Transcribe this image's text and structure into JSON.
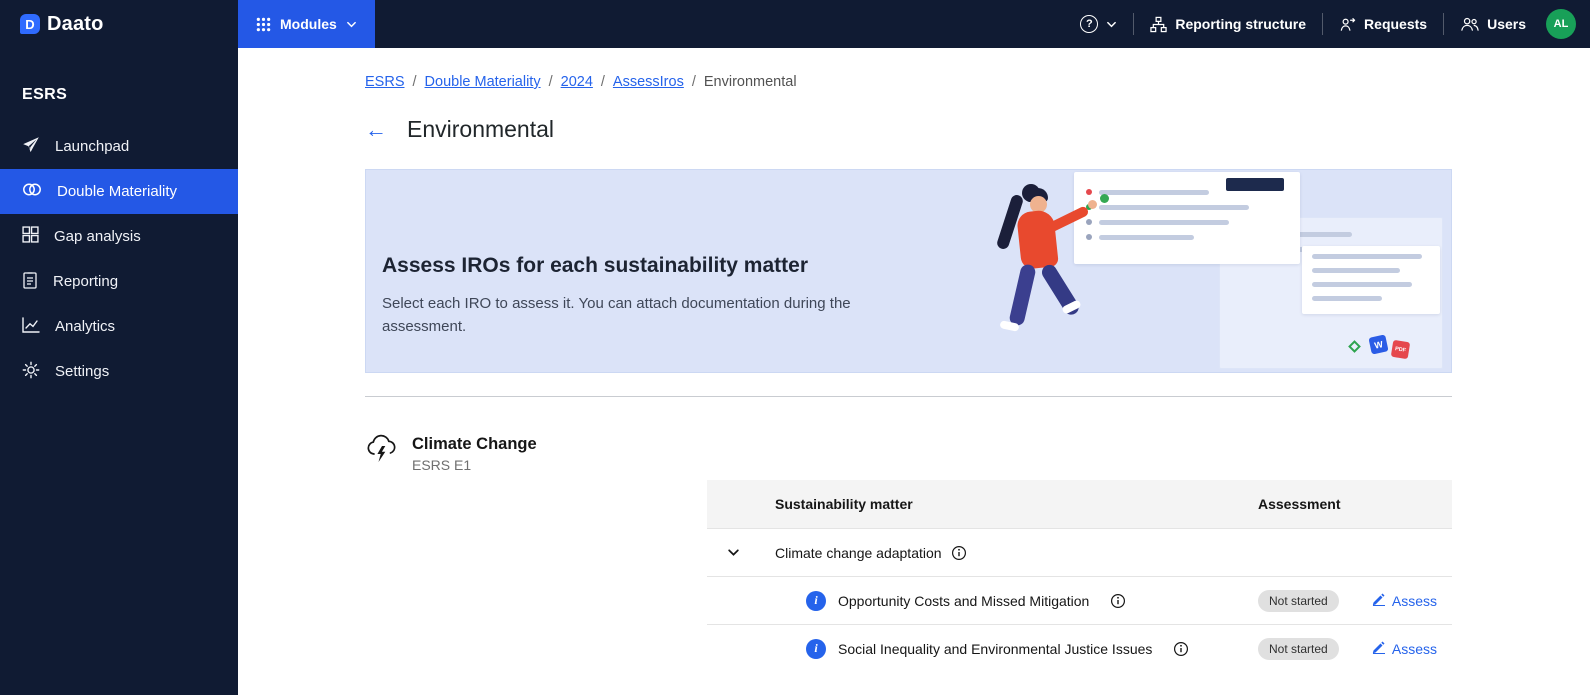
{
  "colors": {
    "navy": "#101b33",
    "accent_blue": "#2458e6",
    "link_blue": "#2563eb",
    "banner_bg": "#dbe3f8",
    "badge_bg": "#e0e0e0",
    "avatar_green": "#18a058"
  },
  "icons": {
    "back": "←",
    "help": "?",
    "info_badge": "i",
    "logo_letter": "D"
  },
  "topbar": {
    "brand": "Daato",
    "modules_label": "Modules",
    "modules_icon": "grid-icon",
    "nav": [
      {
        "label": "Reporting structure",
        "icon": "hierarchy-icon"
      },
      {
        "label": "Requests",
        "icon": "request-user-icon"
      },
      {
        "label": "Users",
        "icon": "users-icon"
      }
    ],
    "avatar_initials": "AL"
  },
  "sidebar": {
    "heading": "ESRS",
    "items": [
      {
        "label": "Launchpad",
        "icon": "paper-plane-icon",
        "active": false
      },
      {
        "label": "Double Materiality",
        "icon": "double-circles-icon",
        "active": true
      },
      {
        "label": "Gap analysis",
        "icon": "grid-squares-icon",
        "active": false
      },
      {
        "label": "Reporting",
        "icon": "clipboard-icon",
        "active": false
      },
      {
        "label": "Analytics",
        "icon": "line-chart-icon",
        "active": false
      },
      {
        "label": "Settings",
        "icon": "gear-icon",
        "active": false
      }
    ]
  },
  "breadcrumb": {
    "separator": "/",
    "items": [
      {
        "label": "ESRS",
        "link": true
      },
      {
        "label": "Double Materiality",
        "link": true
      },
      {
        "label": "2024",
        "link": true
      },
      {
        "label": "AssessIros",
        "link": true
      },
      {
        "label": "Environmental",
        "link": false
      }
    ]
  },
  "page": {
    "title": "Environmental"
  },
  "banner": {
    "title": "Assess IROs for each sustainability matter",
    "description": "Select each IRO to assess it. You can attach documentation during the assessment."
  },
  "section": {
    "title": "Climate Change",
    "subtitle": "ESRS E1",
    "icon": "storm-cloud-icon"
  },
  "table": {
    "headers": [
      "Sustainability matter",
      "Assessment"
    ],
    "group": {
      "label": "Climate change adaptation"
    },
    "rows": [
      {
        "label": "Opportunity Costs and Missed Mitigation",
        "status": "Not started",
        "action": "Assess"
      },
      {
        "label": "Social Inequality and Environmental Justice Issues",
        "status": "Not started",
        "action": "Assess"
      }
    ]
  }
}
